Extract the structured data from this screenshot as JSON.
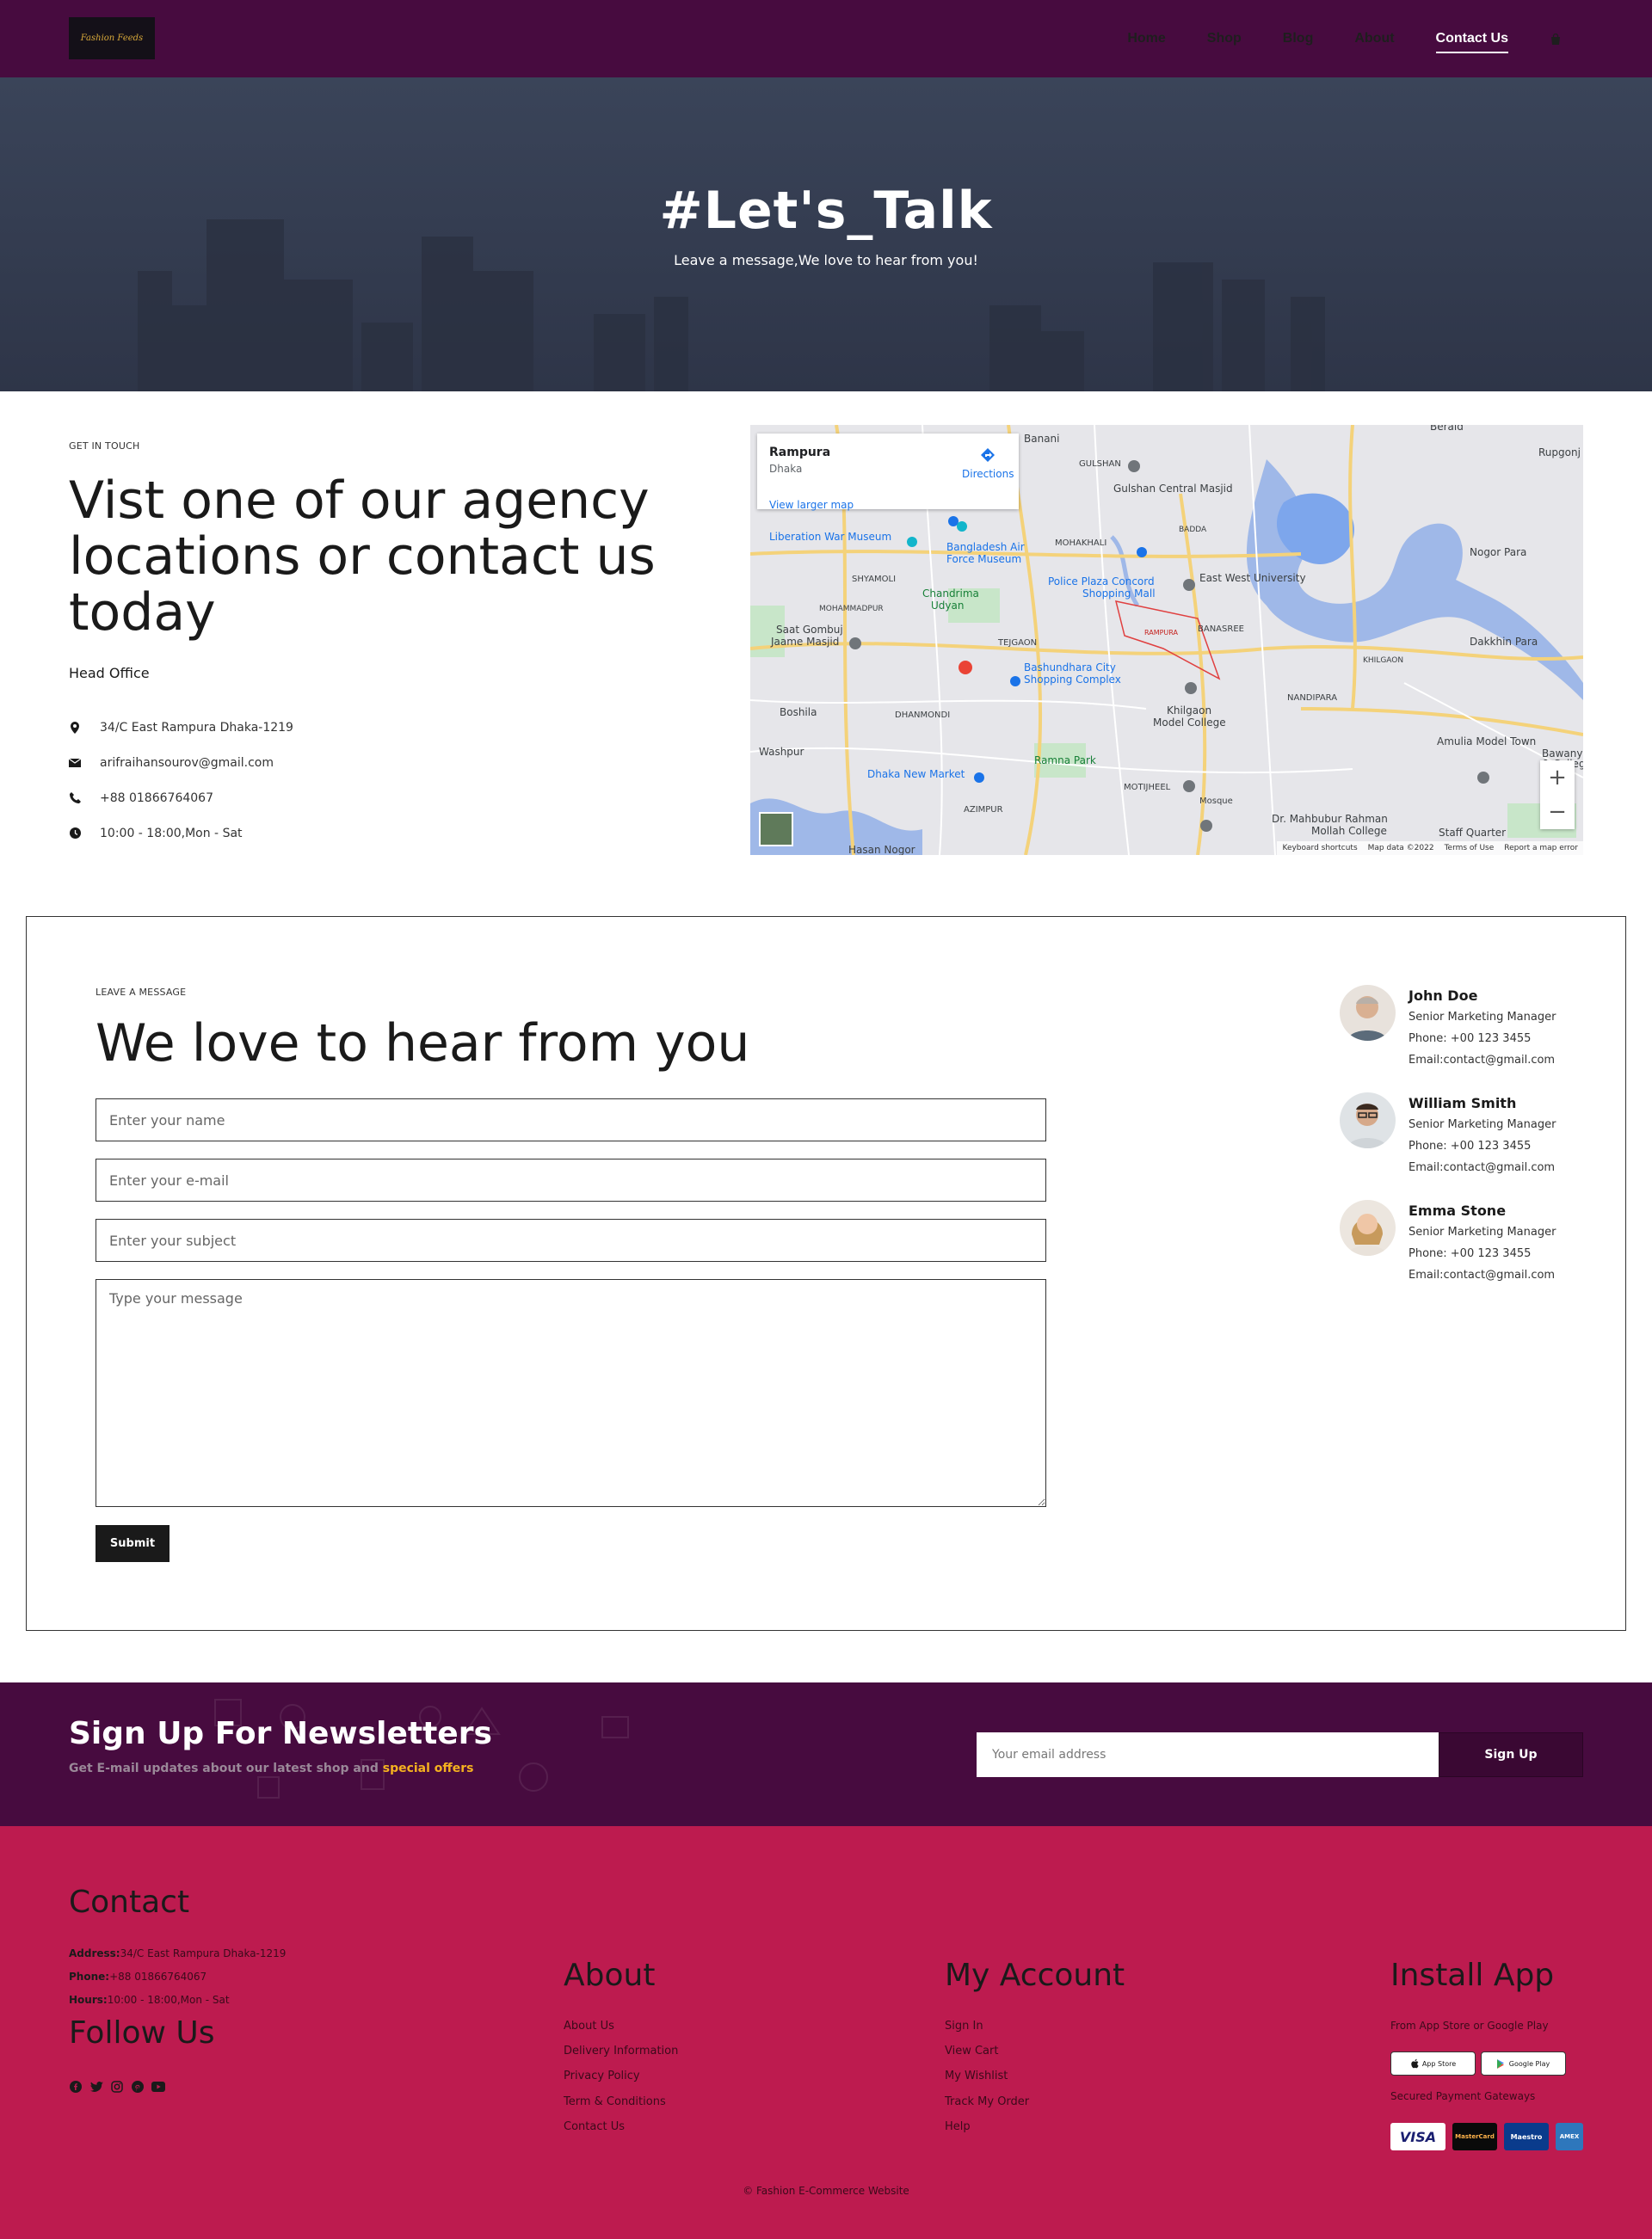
{
  "nav": {
    "logo": "Fashion Feeds",
    "links": [
      "Home",
      "Shop",
      "Blog",
      "About",
      "Contact Us"
    ],
    "active": "Contact Us"
  },
  "hero": {
    "title": "#Let's_Talk",
    "subtitle": "Leave a message,We love to hear from you!"
  },
  "touch": {
    "label": "GET IN TOUCH",
    "title": "Vist one of our agency locations or contact us today",
    "office_heading": "Head Office",
    "address": "34/C East Rampura Dhaka-1219",
    "email": "arifraihansourov@gmail.com",
    "phone": "+88 01866764067",
    "hours": "10:00 - 18:00,Mon - Sat"
  },
  "map": {
    "place": "Rampura",
    "city": "Dhaka",
    "directions": "Directions",
    "larger": "View larger map",
    "footer": [
      "Keyboard shortcuts",
      "Map data ©2022",
      "Terms of Use",
      "Report a map error"
    ],
    "labels": [
      "Banani",
      "GULSHAN",
      "Gulshan Central Masjid",
      "Liberation War Museum",
      "Bangladesh Air Force Museum",
      "MOHAKHALI",
      "SHYAMOLI",
      "Chandrima Udyan",
      "Police Plaza Concord Shopping Mall",
      "East West University",
      "BANASREE",
      "RAMPURA",
      "Nogor Para",
      "Dakkhin Para",
      "Saat Gombuj Jaame Masjid",
      "TEJGAON",
      "Bashundhara City Shopping Complex",
      "NANDIPARA",
      "DHANMONDI",
      "Khilgaon Model College",
      "Boshila",
      "Washpur",
      "Ramna Park",
      "Amulia Model Town",
      "Dhaka New Market",
      "MOTIJHEEL",
      "AZIMPUR",
      "Dr. Mahbubur Rahman Mollah College",
      "Staff Quarter",
      "Hasan Nogor",
      "Rupgonj",
      "Beraid",
      "KHILGAON",
      "BADDA",
      "MOHAMMADPUR",
      "Bawany S & College",
      "Mosque"
    ]
  },
  "form": {
    "label": "LEAVE A MESSAGE",
    "title": "We love to hear from you",
    "name_placeholder": "Enter your name",
    "email_placeholder": "Enter your e-mail",
    "subject_placeholder": "Enter your subject",
    "message_placeholder": "Type your message",
    "submit": "Submit"
  },
  "people": [
    {
      "name": "John Doe",
      "role": "Senior Marketing Manager",
      "phone": "Phone: +00 123 3455",
      "email": "Email:contact@gmail.com"
    },
    {
      "name": "William Smith",
      "role": "Senior Marketing Manager",
      "phone": "Phone: +00 123 3455",
      "email": "Email:contact@gmail.com"
    },
    {
      "name": "Emma Stone",
      "role": "Senior Marketing Manager",
      "phone": "Phone: +00 123 3455",
      "email": "Email:contact@gmail.com"
    }
  ],
  "newsletter": {
    "title": "Sign Up For Newsletters",
    "sub_text": "Get E-mail updates about our latest shop and",
    "sub_highlight": "special offers",
    "placeholder": "Your email address",
    "button": "Sign Up"
  },
  "footer": {
    "contact_heading": "Contact",
    "address_label": "Address:",
    "address": "34/C East Rampura Dhaka-1219",
    "phone_label": "Phone:",
    "phone": "+88 01866764067",
    "hours_label": "Hours:",
    "hours": "10:00 - 18:00,Mon - Sat",
    "follow_heading": "Follow Us",
    "about_heading": "About",
    "about_links": [
      "About Us",
      "Delivery Information",
      "Privacy Policy",
      "Term & Conditions",
      "Contact Us"
    ],
    "account_heading": "My Account",
    "account_links": [
      "Sign In",
      "View Cart",
      "My Wishlist",
      "Track My Order",
      "Help"
    ],
    "app_heading": "Install App",
    "app_sub": "From App Store or Google Play",
    "app_store": "App Store",
    "google_play": "Google Play",
    "payment_label": "Secured Payment Gateways",
    "payments": [
      "VISA",
      "MasterCard",
      "Maestro",
      "AMEX"
    ],
    "copyright": "© Fashion E-Commerce Website"
  },
  "colors": {
    "nav_bg": "#470b3f",
    "hero_bg": "#3a4459",
    "footer_bg": "#bd1b4f",
    "accent": "#f5b21f"
  }
}
